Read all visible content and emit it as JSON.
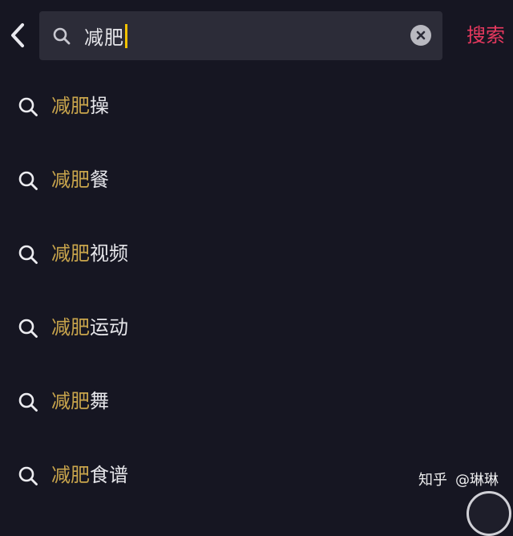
{
  "header": {
    "back_icon": "chevron-left-icon",
    "search_icon": "search-icon",
    "query": "减肥",
    "clear_icon": "clear-circle-icon",
    "search_label": "搜索"
  },
  "suggestions": [
    {
      "highlight": "减肥",
      "rest": "操",
      "icon": "search-icon"
    },
    {
      "highlight": "减肥",
      "rest": "餐",
      "icon": "search-icon"
    },
    {
      "highlight": "减肥",
      "rest": "视频",
      "icon": "search-icon"
    },
    {
      "highlight": "减肥",
      "rest": "运动",
      "icon": "search-icon"
    },
    {
      "highlight": "减肥",
      "rest": "舞",
      "icon": "search-icon"
    },
    {
      "highlight": "减肥",
      "rest": "食谱",
      "icon": "search-icon"
    }
  ],
  "watermark": {
    "site": "知乎",
    "author": "@琳琳"
  },
  "colors": {
    "background": "#161622",
    "search_field": "#2c2c38",
    "highlight": "#c9a54c",
    "accent": "#e8395f",
    "caret": "#f2c200"
  }
}
